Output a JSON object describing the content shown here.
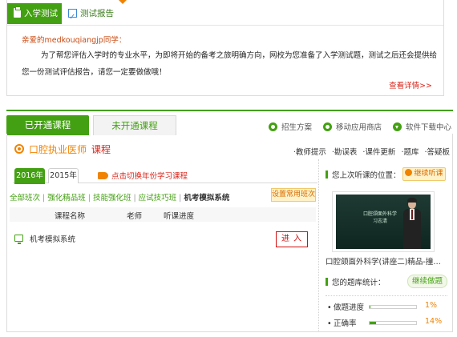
{
  "notice": {
    "tab_test": "入学测试",
    "tab_report": "测试报告",
    "greeting": "亲爱的medkouqiangjp同学：",
    "body": "为了帮您评估入学时的专业水平，为即将开始的备考之旅明确方向，网校为您准备了入学测试题，测试之后还会提供给您一份测试评估报告，请您一定要做做哦！",
    "detail_link": "查看详情>>"
  },
  "course_tabs": {
    "opened": "已开通课程",
    "unopened": "未开通课程"
  },
  "top_links": [
    {
      "label": "招生方案",
      "icon": "circle-icon"
    },
    {
      "label": "移动应用商店",
      "icon": "circle-icon"
    },
    {
      "label": "软件下载中心",
      "icon": "download-icon"
    }
  ],
  "course_title": {
    "main": "口腔执业医师",
    "sub": "课程"
  },
  "right_links": [
    "·教师提示",
    "·勘误表",
    "·课件更新",
    "·题库",
    "·答疑板"
  ],
  "years": {
    "current": "2016年",
    "other": "2015年",
    "switch_hint": "点击切换年份学习课程"
  },
  "filters": {
    "items": [
      "全部班次",
      "强化精品班",
      "技能强化班",
      "应试技巧班",
      "机考模拟系统"
    ],
    "active_index": 4,
    "set_default": "设置常用班次"
  },
  "table": {
    "headers": [
      "课程名称",
      "老师",
      "听课进度"
    ],
    "row_name": "机考模拟系统",
    "enter": "进入"
  },
  "sidebar": {
    "last_position": "您上次听课的位置：",
    "continue_listen": "继续听课",
    "video_line1": "口腔颌面外科学",
    "video_line2": "习志清",
    "video_caption": "口腔颌面外科学(讲座二)精品-撞…",
    "bank_stats": "您的题库统计：",
    "continue_quiz": "继续做题",
    "stats": [
      {
        "label": "做题进度",
        "value": "1%",
        "fraction": 0.01
      },
      {
        "label": "正确率",
        "value": "14%",
        "fraction": 0.14
      }
    ]
  },
  "colors": {
    "brand_green": "#43a012",
    "accent_orange": "#f08300",
    "alert_red": "#d01010"
  }
}
